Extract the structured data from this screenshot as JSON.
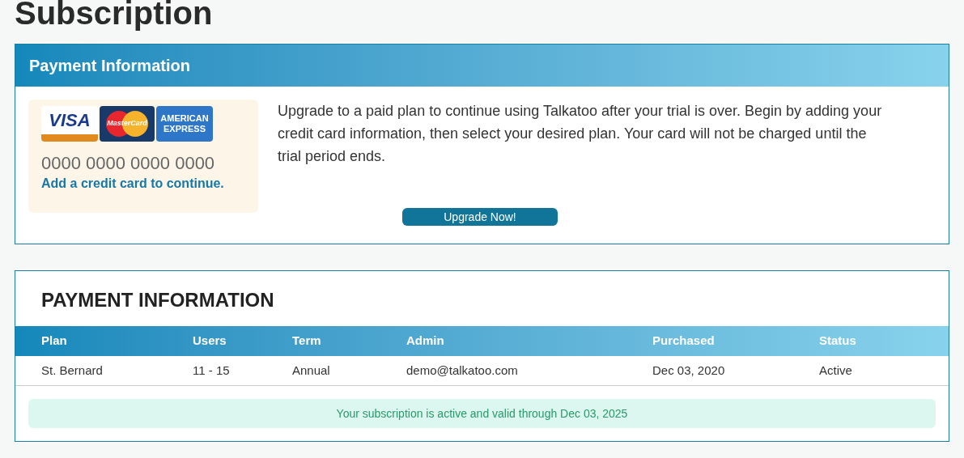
{
  "page_title": "Subscription",
  "payment_panel": {
    "title": "Payment Information",
    "card_logos": [
      {
        "kind": "visa",
        "text": "VISA"
      },
      {
        "kind": "mastercard",
        "text": "MasterCard"
      },
      {
        "kind": "amex",
        "text": "AMERICAN EXPRESS"
      }
    ],
    "card_number": "0000 0000 0000 0000",
    "card_prompt": "Add a credit card to continue.",
    "message": "Upgrade to a paid plan to continue using Talkatoo after your trial is over. Begin by adding your credit card information, then select your desired plan. Your card will not be charged until the trial period ends.",
    "button": "Upgrade Now!"
  },
  "subscription_panel": {
    "title": "PAYMENT INFORMATION",
    "table": {
      "columns": [
        "Plan",
        "Users",
        "Term",
        "Admin",
        "Purchased",
        "Status"
      ],
      "rows": [
        [
          "St. Bernard",
          "11 - 15",
          "Annual",
          "demo@talkatoo.com",
          "Dec 03, 2020",
          "Active"
        ]
      ]
    },
    "notice": "Your subscription is active and valid through Dec 03, 2025"
  }
}
